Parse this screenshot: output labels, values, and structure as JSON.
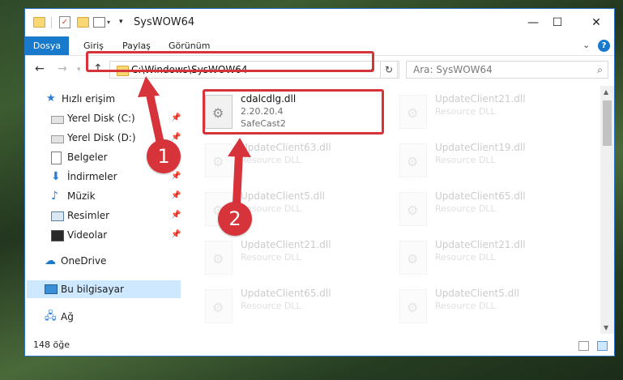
{
  "window": {
    "title": "SysWOW64",
    "controls": {
      "minimize": "—",
      "maximize": "☐",
      "close": "✕"
    }
  },
  "ribbon": {
    "tabs": [
      "Dosya",
      "Giriş",
      "Paylaş",
      "Görünüm"
    ],
    "help": "?"
  },
  "address": {
    "path": "C:\\Windows\\SysWOW64",
    "search_placeholder": "Ara: SysWOW64"
  },
  "sidebar": {
    "items": [
      {
        "label": "Hızlı erişim",
        "icon": "star-icon"
      },
      {
        "label": "Yerel Disk (C:)",
        "icon": "drive-icon"
      },
      {
        "label": "Yerel Disk (D:)",
        "icon": "drive-icon"
      },
      {
        "label": "Belgeler",
        "icon": "documents-icon"
      },
      {
        "label": "İndirmeler",
        "icon": "download-icon"
      },
      {
        "label": "Müzik",
        "icon": "music-icon"
      },
      {
        "label": "Resimler",
        "icon": "pictures-icon"
      },
      {
        "label": "Videolar",
        "icon": "video-icon"
      },
      {
        "label": "OneDrive",
        "icon": "cloud-icon"
      },
      {
        "label": "Bu bilgisayar",
        "icon": "computer-icon"
      },
      {
        "label": "Ağ",
        "icon": "network-icon"
      }
    ]
  },
  "files": {
    "highlighted": {
      "name": "cdalcdlg.dll",
      "version": "2.20.20.4",
      "company": "SafeCast2"
    },
    "others": [
      {
        "name": "UpdateClient21.dll",
        "desc": "Resource DLL"
      },
      {
        "name": "UpdateClient63.dll",
        "desc": "Resource DLL"
      },
      {
        "name": "UpdateClient19.dll",
        "desc": "Resource DLL"
      },
      {
        "name": "UpdateClient5.dll",
        "desc": "Resource DLL"
      },
      {
        "name": "UpdateClient65.dll",
        "desc": "Resource DLL"
      },
      {
        "name": "UpdateClient21.dll",
        "desc": "Resource DLL"
      },
      {
        "name": "UpdateClient21.dll",
        "desc": "Resource DLL"
      },
      {
        "name": "UpdateClient65.dll",
        "desc": "Resource DLL"
      },
      {
        "name": "UpdateClient5.dll",
        "desc": "Resource DLL"
      }
    ]
  },
  "status": {
    "count": "148 öğe"
  },
  "callouts": {
    "one": "1",
    "two": "2"
  },
  "colors": {
    "accent": "#1979ca",
    "highlight": "#d6333b",
    "selection": "#cde8ff"
  }
}
